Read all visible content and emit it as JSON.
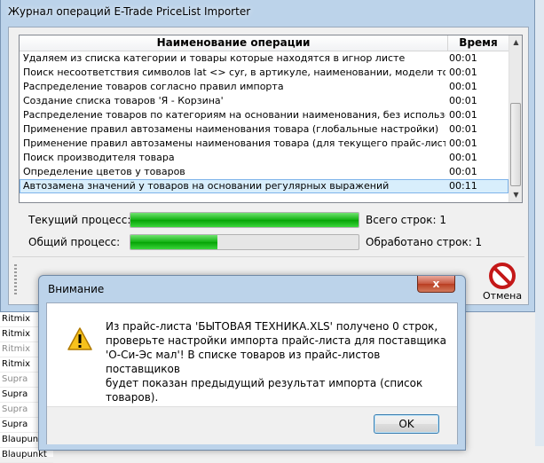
{
  "window": {
    "title": "Журнал операций E-Trade PriceList Importer"
  },
  "log": {
    "columns": {
      "operation": "Наименование операции",
      "time": "Время"
    },
    "rows": [
      {
        "operation": "Удаляем из списка категории и товары которые находятся в игнор листе",
        "time": "00:01"
      },
      {
        "operation": "Поиск несоответствия символов lat <> cyr, в артикуле, наименовании, модели товара",
        "time": "00:01"
      },
      {
        "operation": "Распределение товаров согласно правил импорта",
        "time": "00:01"
      },
      {
        "operation": "Создание списка товаров 'Я - Корзина'",
        "time": "00:01"
      },
      {
        "operation": "Распределение товаров по категориям на основании наименования, без использования",
        "time": "00:01"
      },
      {
        "operation": "Применение правил автозамены наименования товара (глобальные настройки)",
        "time": "00:01"
      },
      {
        "operation": "Применение правил автозамены наименования товара (для текущего прайс-листа)",
        "time": "00:01"
      },
      {
        "operation": "Поиск производителя товара",
        "time": "00:01"
      },
      {
        "operation": "Определение цветов у товаров",
        "time": "00:01"
      },
      {
        "operation": "Автозамена значений у товаров на основании регулярных выражений",
        "time": "00:11"
      }
    ]
  },
  "progress": {
    "current_label": "Текущий процесс:",
    "current_fraction": 1.0,
    "total_label": "Общий процесс:",
    "total_fraction": 0.38,
    "rows_total": "Всего строк: 1",
    "rows_processed": "Обработано строк: 1",
    "bar_color": "#10b010"
  },
  "toolbar": {
    "cancel_label": "Отмена",
    "cancel_icon": "cancel-icon"
  },
  "dialog": {
    "title": "Внимание",
    "close_glyph": "x",
    "icon": "warning-icon",
    "message": [
      "Из прайс-листа 'БЫТОВАЯ ТЕХНИКА.XLS' получено 0 строк,",
      "проверьте настройки импорта прайс-листа для поставщика",
      "'О-Си-Эс мал'! В списке товаров из прайс-листов поставщиков",
      "будет показан предыдущий результат импорта (список товаров)."
    ],
    "ok_label": "OK"
  },
  "background_list": [
    {
      "text": "Ritmix",
      "muted": false
    },
    {
      "text": "Ritmix",
      "muted": false
    },
    {
      "text": "Ritmix",
      "muted": true
    },
    {
      "text": "Ritmix",
      "muted": false
    },
    {
      "text": "Supra",
      "muted": true
    },
    {
      "text": "Supra",
      "muted": false
    },
    {
      "text": "Supra",
      "muted": true
    },
    {
      "text": "Supra",
      "muted": false
    },
    {
      "text": "Blaupunkt",
      "muted": false
    },
    {
      "text": "Blaupunkt",
      "muted": false
    }
  ]
}
